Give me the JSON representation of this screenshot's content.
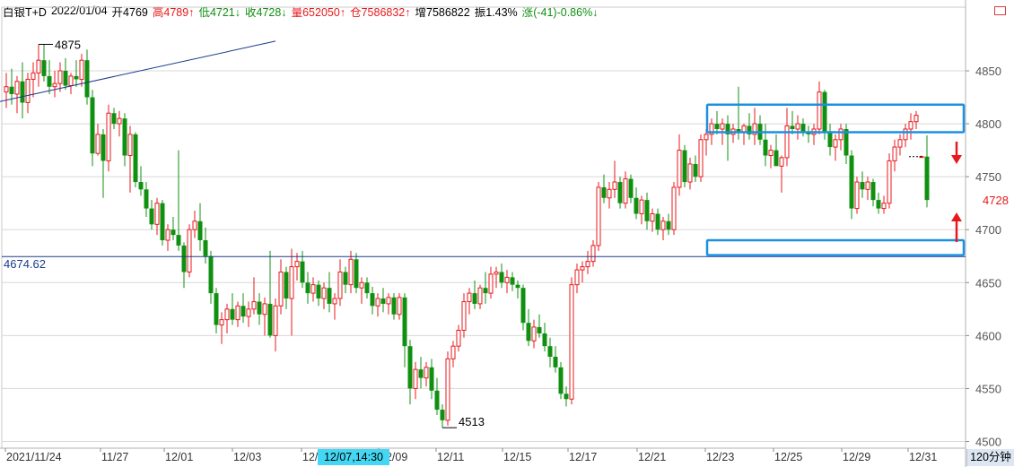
{
  "header": {
    "instrument": "白银T+D",
    "date": "2022/01/04",
    "open_label": "开",
    "open": "4769",
    "high_label": "高",
    "high": "4789↑",
    "low_label": "低",
    "low": "4721↓",
    "close_label": "收",
    "close": "4728↓",
    "volume_label": "量",
    "volume": "652050↑",
    "oi_label": "仓",
    "oi": "7586832↑",
    "incr_label": "增",
    "incr": "7586822",
    "amp_label": "振",
    "amp": "1.43%",
    "change_label": "涨",
    "change": "(-41)-0.86%↓"
  },
  "colors": {
    "up": "#e8191c",
    "down": "#109010",
    "grid": "#d8d8d8",
    "box": "#1e90e0",
    "trendline": "#1a3a8a",
    "hline": "#1a3a8a",
    "price_tag_bg": "#ffffff",
    "price_tag_text": "#e8191c",
    "arrow": "#e8191c"
  },
  "corner_icon": "square-icon",
  "time_axis": {
    "labels": [
      "2021/11/24",
      "11/27",
      "12/01",
      "12/03",
      "12/07",
      "12/09",
      "12/11",
      "12/15",
      "12/17",
      "12/21",
      "12/23",
      "12/25",
      "12/29",
      "12/31"
    ],
    "cursor_label": "12/07,14:30",
    "period_label": "120分钟"
  },
  "chart_data": {
    "type": "candlestick",
    "title": "白银T+D",
    "y_ticks": [
      4500,
      4550,
      4600,
      4650,
      4700,
      4750,
      4800,
      4850
    ],
    "ylim": [
      4493,
      4899
    ],
    "grid": true,
    "annotations": {
      "max_label": "4875",
      "min_label": "4513",
      "hline_value": 4674.62,
      "hline_label": "4674.62",
      "last_price": "4728",
      "trendline": [
        {
          "i": 0,
          "price": 4821
        },
        {
          "i": 50,
          "price": 4878
        }
      ],
      "resistance_box": {
        "i0": 131,
        "i1": 177,
        "top": 4818,
        "bottom": 4792
      },
      "support_box": {
        "i0": 131,
        "i1": 177,
        "top": 4690,
        "bottom": 4676
      }
    },
    "candles": [
      {
        "o": 4830,
        "h": 4848,
        "l": 4815,
        "c": 4835
      },
      {
        "o": 4835,
        "h": 4852,
        "l": 4818,
        "c": 4828
      },
      {
        "o": 4828,
        "h": 4845,
        "l": 4810,
        "c": 4840
      },
      {
        "o": 4840,
        "h": 4858,
        "l": 4805,
        "c": 4820
      },
      {
        "o": 4820,
        "h": 4848,
        "l": 4810,
        "c": 4842
      },
      {
        "o": 4842,
        "h": 4858,
        "l": 4825,
        "c": 4848
      },
      {
        "o": 4848,
        "h": 4875,
        "l": 4835,
        "c": 4860
      },
      {
        "o": 4860,
        "h": 4875,
        "l": 4840,
        "c": 4845
      },
      {
        "o": 4845,
        "h": 4860,
        "l": 4828,
        "c": 4835
      },
      {
        "o": 4835,
        "h": 4850,
        "l": 4825,
        "c": 4838
      },
      {
        "o": 4838,
        "h": 4858,
        "l": 4830,
        "c": 4850
      },
      {
        "o": 4850,
        "h": 4862,
        "l": 4832,
        "c": 4836
      },
      {
        "o": 4836,
        "h": 4848,
        "l": 4828,
        "c": 4845
      },
      {
        "o": 4845,
        "h": 4860,
        "l": 4835,
        "c": 4842
      },
      {
        "o": 4842,
        "h": 4866,
        "l": 4835,
        "c": 4860
      },
      {
        "o": 4860,
        "h": 4870,
        "l": 4818,
        "c": 4825
      },
      {
        "o": 4825,
        "h": 4832,
        "l": 4760,
        "c": 4772
      },
      {
        "o": 4772,
        "h": 4800,
        "l": 4770,
        "c": 4790
      },
      {
        "o": 4790,
        "h": 4795,
        "l": 4730,
        "c": 4765
      },
      {
        "o": 4765,
        "h": 4818,
        "l": 4755,
        "c": 4810
      },
      {
        "o": 4810,
        "h": 4815,
        "l": 4795,
        "c": 4800
      },
      {
        "o": 4800,
        "h": 4812,
        "l": 4788,
        "c": 4805
      },
      {
        "o": 4805,
        "h": 4810,
        "l": 4760,
        "c": 4770
      },
      {
        "o": 4770,
        "h": 4798,
        "l": 4735,
        "c": 4790
      },
      {
        "o": 4790,
        "h": 4792,
        "l": 4740,
        "c": 4745
      },
      {
        "o": 4745,
        "h": 4760,
        "l": 4732,
        "c": 4738
      },
      {
        "o": 4738,
        "h": 4745,
        "l": 4712,
        "c": 4720
      },
      {
        "o": 4720,
        "h": 4728,
        "l": 4700,
        "c": 4705
      },
      {
        "o": 4705,
        "h": 4730,
        "l": 4695,
        "c": 4725
      },
      {
        "o": 4725,
        "h": 4728,
        "l": 4685,
        "c": 4690
      },
      {
        "o": 4690,
        "h": 4705,
        "l": 4680,
        "c": 4700
      },
      {
        "o": 4700,
        "h": 4712,
        "l": 4690,
        "c": 4695
      },
      {
        "o": 4695,
        "h": 4775,
        "l": 4680,
        "c": 4685
      },
      {
        "o": 4685,
        "h": 4688,
        "l": 4645,
        "c": 4660
      },
      {
        "o": 4660,
        "h": 4705,
        "l": 4655,
        "c": 4700
      },
      {
        "o": 4700,
        "h": 4718,
        "l": 4692,
        "c": 4708
      },
      {
        "o": 4708,
        "h": 4725,
        "l": 4680,
        "c": 4690
      },
      {
        "o": 4690,
        "h": 4702,
        "l": 4668,
        "c": 4675
      },
      {
        "o": 4675,
        "h": 4680,
        "l": 4630,
        "c": 4640
      },
      {
        "o": 4640,
        "h": 4645,
        "l": 4602,
        "c": 4610
      },
      {
        "o": 4610,
        "h": 4622,
        "l": 4592,
        "c": 4615
      },
      {
        "o": 4615,
        "h": 4630,
        "l": 4602,
        "c": 4625
      },
      {
        "o": 4625,
        "h": 4640,
        "l": 4610,
        "c": 4615
      },
      {
        "o": 4615,
        "h": 4632,
        "l": 4608,
        "c": 4628
      },
      {
        "o": 4628,
        "h": 4640,
        "l": 4612,
        "c": 4618
      },
      {
        "o": 4618,
        "h": 4632,
        "l": 4608,
        "c": 4625
      },
      {
        "o": 4625,
        "h": 4655,
        "l": 4620,
        "c": 4632
      },
      {
        "o": 4632,
        "h": 4640,
        "l": 4610,
        "c": 4620
      },
      {
        "o": 4620,
        "h": 4636,
        "l": 4600,
        "c": 4630
      },
      {
        "o": 4630,
        "h": 4680,
        "l": 4598,
        "c": 4600
      },
      {
        "o": 4600,
        "h": 4635,
        "l": 4585,
        "c": 4628
      },
      {
        "o": 4628,
        "h": 4672,
        "l": 4620,
        "c": 4660
      },
      {
        "o": 4660,
        "h": 4665,
        "l": 4625,
        "c": 4635
      },
      {
        "o": 4635,
        "h": 4682,
        "l": 4600,
        "c": 4665
      },
      {
        "o": 4665,
        "h": 4678,
        "l": 4652,
        "c": 4670
      },
      {
        "o": 4670,
        "h": 4680,
        "l": 4645,
        "c": 4650
      },
      {
        "o": 4650,
        "h": 4660,
        "l": 4630,
        "c": 4640
      },
      {
        "o": 4640,
        "h": 4655,
        "l": 4632,
        "c": 4648
      },
      {
        "o": 4648,
        "h": 4652,
        "l": 4628,
        "c": 4635
      },
      {
        "o": 4635,
        "h": 4650,
        "l": 4625,
        "c": 4645
      },
      {
        "o": 4645,
        "h": 4660,
        "l": 4622,
        "c": 4630
      },
      {
        "o": 4630,
        "h": 4640,
        "l": 4615,
        "c": 4635
      },
      {
        "o": 4635,
        "h": 4672,
        "l": 4628,
        "c": 4660
      },
      {
        "o": 4660,
        "h": 4665,
        "l": 4640,
        "c": 4648
      },
      {
        "o": 4648,
        "h": 4680,
        "l": 4640,
        "c": 4672
      },
      {
        "o": 4672,
        "h": 4678,
        "l": 4640,
        "c": 4645
      },
      {
        "o": 4645,
        "h": 4655,
        "l": 4630,
        "c": 4650
      },
      {
        "o": 4650,
        "h": 4655,
        "l": 4635,
        "c": 4640
      },
      {
        "o": 4640,
        "h": 4646,
        "l": 4620,
        "c": 4628
      },
      {
        "o": 4628,
        "h": 4640,
        "l": 4618,
        "c": 4635
      },
      {
        "o": 4635,
        "h": 4645,
        "l": 4622,
        "c": 4630
      },
      {
        "o": 4630,
        "h": 4640,
        "l": 4620,
        "c": 4636
      },
      {
        "o": 4636,
        "h": 4640,
        "l": 4615,
        "c": 4620
      },
      {
        "o": 4620,
        "h": 4640,
        "l": 4615,
        "c": 4636
      },
      {
        "o": 4636,
        "h": 4640,
        "l": 4570,
        "c": 4590
      },
      {
        "o": 4590,
        "h": 4596,
        "l": 4535,
        "c": 4550
      },
      {
        "o": 4550,
        "h": 4575,
        "l": 4540,
        "c": 4568
      },
      {
        "o": 4568,
        "h": 4580,
        "l": 4550,
        "c": 4560
      },
      {
        "o": 4560,
        "h": 4575,
        "l": 4552,
        "c": 4570
      },
      {
        "o": 4570,
        "h": 4578,
        "l": 4540,
        "c": 4548
      },
      {
        "o": 4548,
        "h": 4560,
        "l": 4525,
        "c": 4530
      },
      {
        "o": 4530,
        "h": 4535,
        "l": 4513,
        "c": 4520
      },
      {
        "o": 4520,
        "h": 4585,
        "l": 4515,
        "c": 4578
      },
      {
        "o": 4578,
        "h": 4595,
        "l": 4570,
        "c": 4590
      },
      {
        "o": 4590,
        "h": 4610,
        "l": 4585,
        "c": 4605
      },
      {
        "o": 4605,
        "h": 4640,
        "l": 4598,
        "c": 4632
      },
      {
        "o": 4632,
        "h": 4645,
        "l": 4620,
        "c": 4640
      },
      {
        "o": 4640,
        "h": 4652,
        "l": 4625,
        "c": 4630
      },
      {
        "o": 4630,
        "h": 4648,
        "l": 4625,
        "c": 4645
      },
      {
        "o": 4645,
        "h": 4660,
        "l": 4630,
        "c": 4640
      },
      {
        "o": 4640,
        "h": 4665,
        "l": 4635,
        "c": 4658
      },
      {
        "o": 4658,
        "h": 4665,
        "l": 4645,
        "c": 4660
      },
      {
        "o": 4660,
        "h": 4668,
        "l": 4645,
        "c": 4650
      },
      {
        "o": 4650,
        "h": 4662,
        "l": 4640,
        "c": 4655
      },
      {
        "o": 4655,
        "h": 4660,
        "l": 4642,
        "c": 4648
      },
      {
        "o": 4648,
        "h": 4652,
        "l": 4635,
        "c": 4645
      },
      {
        "o": 4645,
        "h": 4648,
        "l": 4605,
        "c": 4612
      },
      {
        "o": 4612,
        "h": 4625,
        "l": 4590,
        "c": 4595
      },
      {
        "o": 4595,
        "h": 4615,
        "l": 4588,
        "c": 4608
      },
      {
        "o": 4608,
        "h": 4620,
        "l": 4598,
        "c": 4602
      },
      {
        "o": 4602,
        "h": 4612,
        "l": 4585,
        "c": 4590
      },
      {
        "o": 4590,
        "h": 4598,
        "l": 4570,
        "c": 4580
      },
      {
        "o": 4580,
        "h": 4590,
        "l": 4565,
        "c": 4570
      },
      {
        "o": 4570,
        "h": 4575,
        "l": 4540,
        "c": 4545
      },
      {
        "o": 4545,
        "h": 4552,
        "l": 4533,
        "c": 4540
      },
      {
        "o": 4540,
        "h": 4655,
        "l": 4535,
        "c": 4648
      },
      {
        "o": 4648,
        "h": 4668,
        "l": 4640,
        "c": 4662
      },
      {
        "o": 4662,
        "h": 4670,
        "l": 4650,
        "c": 4665
      },
      {
        "o": 4665,
        "h": 4680,
        "l": 4658,
        "c": 4670
      },
      {
        "o": 4670,
        "h": 4690,
        "l": 4665,
        "c": 4685
      },
      {
        "o": 4685,
        "h": 4745,
        "l": 4680,
        "c": 4740
      },
      {
        "o": 4740,
        "h": 4752,
        "l": 4725,
        "c": 4730
      },
      {
        "o": 4730,
        "h": 4745,
        "l": 4720,
        "c": 4738
      },
      {
        "o": 4738,
        "h": 4765,
        "l": 4730,
        "c": 4745
      },
      {
        "o": 4745,
        "h": 4750,
        "l": 4720,
        "c": 4725
      },
      {
        "o": 4725,
        "h": 4755,
        "l": 4720,
        "c": 4748
      },
      {
        "o": 4748,
        "h": 4752,
        "l": 4725,
        "c": 4730
      },
      {
        "o": 4730,
        "h": 4740,
        "l": 4710,
        "c": 4715
      },
      {
        "o": 4715,
        "h": 4732,
        "l": 4705,
        "c": 4728
      },
      {
        "o": 4728,
        "h": 4735,
        "l": 4700,
        "c": 4708
      },
      {
        "o": 4708,
        "h": 4720,
        "l": 4698,
        "c": 4715
      },
      {
        "o": 4715,
        "h": 4720,
        "l": 4695,
        "c": 4700
      },
      {
        "o": 4700,
        "h": 4712,
        "l": 4690,
        "c": 4708
      },
      {
        "o": 4708,
        "h": 4715,
        "l": 4695,
        "c": 4700
      },
      {
        "o": 4700,
        "h": 4745,
        "l": 4695,
        "c": 4740
      },
      {
        "o": 4740,
        "h": 4790,
        "l": 4732,
        "c": 4775
      },
      {
        "o": 4775,
        "h": 4780,
        "l": 4740,
        "c": 4745
      },
      {
        "o": 4745,
        "h": 4768,
        "l": 4738,
        "c": 4762
      },
      {
        "o": 4762,
        "h": 4770,
        "l": 4745,
        "c": 4750
      },
      {
        "o": 4750,
        "h": 4790,
        "l": 4745,
        "c": 4785
      },
      {
        "o": 4785,
        "h": 4795,
        "l": 4770,
        "c": 4790
      },
      {
        "o": 4790,
        "h": 4805,
        "l": 4780,
        "c": 4800
      },
      {
        "o": 4800,
        "h": 4812,
        "l": 4790,
        "c": 4795
      },
      {
        "o": 4795,
        "h": 4805,
        "l": 4780,
        "c": 4800
      },
      {
        "o": 4800,
        "h": 4808,
        "l": 4765,
        "c": 4790
      },
      {
        "o": 4790,
        "h": 4800,
        "l": 4782,
        "c": 4795
      },
      {
        "o": 4795,
        "h": 4835,
        "l": 4785,
        "c": 4792
      },
      {
        "o": 4792,
        "h": 4800,
        "l": 4780,
        "c": 4798
      },
      {
        "o": 4798,
        "h": 4810,
        "l": 4785,
        "c": 4790
      },
      {
        "o": 4790,
        "h": 4815,
        "l": 4780,
        "c": 4800
      },
      {
        "o": 4800,
        "h": 4808,
        "l": 4780,
        "c": 4785
      },
      {
        "o": 4785,
        "h": 4800,
        "l": 4760,
        "c": 4770
      },
      {
        "o": 4770,
        "h": 4780,
        "l": 4758,
        "c": 4775
      },
      {
        "o": 4775,
        "h": 4790,
        "l": 4765,
        "c": 4760
      },
      {
        "o": 4760,
        "h": 4770,
        "l": 4735,
        "c": 4768
      },
      {
        "o": 4768,
        "h": 4815,
        "l": 4760,
        "c": 4798
      },
      {
        "o": 4798,
        "h": 4812,
        "l": 4790,
        "c": 4795
      },
      {
        "o": 4795,
        "h": 4808,
        "l": 4785,
        "c": 4800
      },
      {
        "o": 4800,
        "h": 4805,
        "l": 4788,
        "c": 4792
      },
      {
        "o": 4792,
        "h": 4798,
        "l": 4782,
        "c": 4790
      },
      {
        "o": 4790,
        "h": 4800,
        "l": 4780,
        "c": 4795
      },
      {
        "o": 4795,
        "h": 4840,
        "l": 4790,
        "c": 4830
      },
      {
        "o": 4830,
        "h": 4832,
        "l": 4785,
        "c": 4792
      },
      {
        "o": 4792,
        "h": 4800,
        "l": 4770,
        "c": 4778
      },
      {
        "o": 4778,
        "h": 4790,
        "l": 4765,
        "c": 4785
      },
      {
        "o": 4785,
        "h": 4800,
        "l": 4775,
        "c": 4795
      },
      {
        "o": 4795,
        "h": 4800,
        "l": 4762,
        "c": 4770
      },
      {
        "o": 4770,
        "h": 4775,
        "l": 4710,
        "c": 4720
      },
      {
        "o": 4720,
        "h": 4750,
        "l": 4715,
        "c": 4745
      },
      {
        "o": 4745,
        "h": 4755,
        "l": 4730,
        "c": 4738
      },
      {
        "o": 4738,
        "h": 4750,
        "l": 4728,
        "c": 4745
      },
      {
        "o": 4745,
        "h": 4748,
        "l": 4722,
        "c": 4728
      },
      {
        "o": 4728,
        "h": 4735,
        "l": 4715,
        "c": 4720
      },
      {
        "o": 4720,
        "h": 4732,
        "l": 4715,
        "c": 4725
      },
      {
        "o": 4725,
        "h": 4772,
        "l": 4720,
        "c": 4765
      },
      {
        "o": 4765,
        "h": 4785,
        "l": 4755,
        "c": 4778
      },
      {
        "o": 4778,
        "h": 4790,
        "l": 4770,
        "c": 4785
      },
      {
        "o": 4785,
        "h": 4800,
        "l": 4778,
        "c": 4795
      },
      {
        "o": 4795,
        "h": 4810,
        "l": 4785,
        "c": 4802
      },
      {
        "o": 4802,
        "h": 4812,
        "l": 4795,
        "c": 4808
      },
      {
        "o": 4769,
        "h": 4770,
        "l": 4768,
        "c": 4769
      },
      {
        "o": 4769,
        "h": 4789,
        "l": 4721,
        "c": 4728
      }
    ]
  }
}
